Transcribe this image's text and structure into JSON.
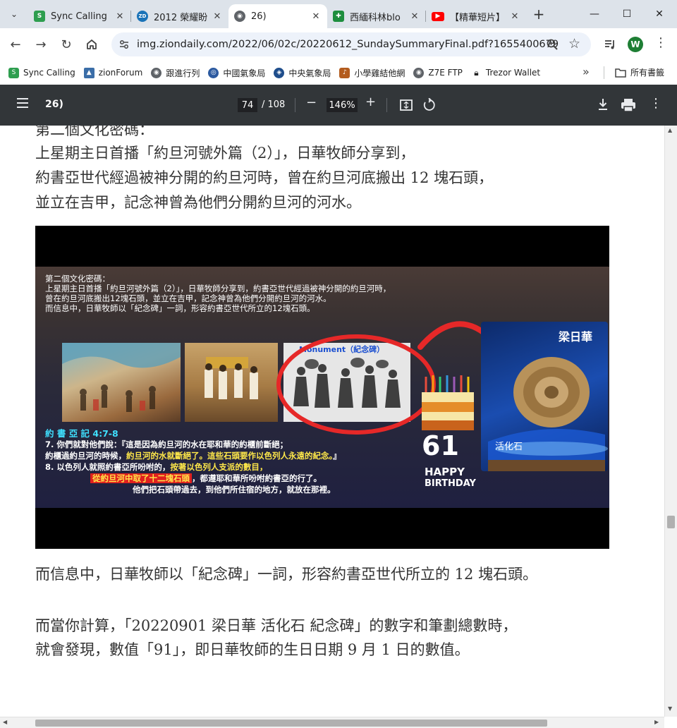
{
  "tabs": [
    {
      "title": "Sync Calling",
      "favicon_color": "#2e9e4f"
    },
    {
      "title": "2012 榮耀盼",
      "favicon_color": "#1a73b8"
    },
    {
      "title": "26)",
      "favicon_color": "#5f6368"
    },
    {
      "title": "西緬科林blo",
      "favicon_color": "#1e8e3e"
    },
    {
      "title": "【精華短片】",
      "favicon_color": "#ff0000"
    }
  ],
  "window": {
    "minimize": "—",
    "maximize": "☐",
    "close": "✕"
  },
  "address": {
    "url": "img.ziondaily.com/2022/06/02c/20220612_SundaySummaryFinal.pdf?1655400679",
    "profile_initial": "W"
  },
  "bookmarks": {
    "items": [
      {
        "label": "Sync Calling",
        "color": "#2e9e4f"
      },
      {
        "label": "zionForum",
        "color": "#3b6ea8"
      },
      {
        "label": "跟進行列",
        "color": "#5f6368"
      },
      {
        "label": "中國氣象局",
        "color": "#2c5aa0"
      },
      {
        "label": "中央氣象局",
        "color": "#1f4e8c"
      },
      {
        "label": "小學雞結他網",
        "color": "#b35c1e"
      },
      {
        "label": "Z7E FTP",
        "color": "#5f6368"
      },
      {
        "label": "Trezor Wallet",
        "color": "#222222"
      }
    ],
    "more": "»",
    "folder": "所有書籤"
  },
  "pdf": {
    "title": "26)",
    "current_page": "74",
    "total_pages": "/ 108",
    "zoom": "146%"
  },
  "doc": {
    "line0": "第二個文化密碼：",
    "line1": "上星期主日首播「約旦河號外篇（2）」，日華牧師分享到，",
    "line2": "約書亞世代經過被神分開的約旦河時，曾在約旦河底搬出 12 塊石頭，",
    "line3": "並立在吉甲，記念神曾為他們分開約旦河的河水。",
    "line4": "而信息中，日華牧師以「紀念碑」一詞，形容約書亞世代所立的 12 塊石頭。",
    "line5": "而當你計算，「20220901  梁日華  活化石  紀念碑」的數字和筆劃總數時，",
    "line6": "就會發現，數值「91」，即日華牧師的生日日期 9 月 1 日的數值。"
  },
  "slide": {
    "header1": "第二個文化密碼：",
    "header2": "上星期主日首播「約旦河號外篇（2）」，日華牧師分享到，約書亞世代經過被神分開的約旦河時，",
    "header3": "曾在約旦河底搬出12塊石頭，並立在吉甲，記念神曾為他們分開約旦河的河水。",
    "header4": "而信息中，日華牧師以「紀念碑」一詞，形容約書亞世代所立的12塊石頭。",
    "monument_label": "Monument（紀念碑）",
    "verse_ref": "約 書 亞 記 4:7-8",
    "verse1": "7. 你們就對他們說：『這是因為約旦河的水在耶和華的約櫃前斷絕；",
    "verse2a": "約櫃過約旦河的時候，",
    "verse2b": "約旦河的水就斷絕了。",
    "verse2c": "這些石頭要作以色列人永遠的紀念。",
    "verse2d": "』",
    "verse3a": "8. 以色列人就照約書亞所吩咐的，",
    "verse3b": "按著以色列人支派的數目，",
    "verse4a": "從約旦河中取了十二塊石頭",
    "verse4b": "，都遵耶和華所吩咐約書亞的行了。",
    "verse5": "他們把石頭帶過去，到他們所住宿的地方，就放在那裡。",
    "birthday_num": "61",
    "birthday1": "HAPPY",
    "birthday2": "BIRTHDAY",
    "trophy_text": "梁日華",
    "trophy_sub": "活化石"
  }
}
